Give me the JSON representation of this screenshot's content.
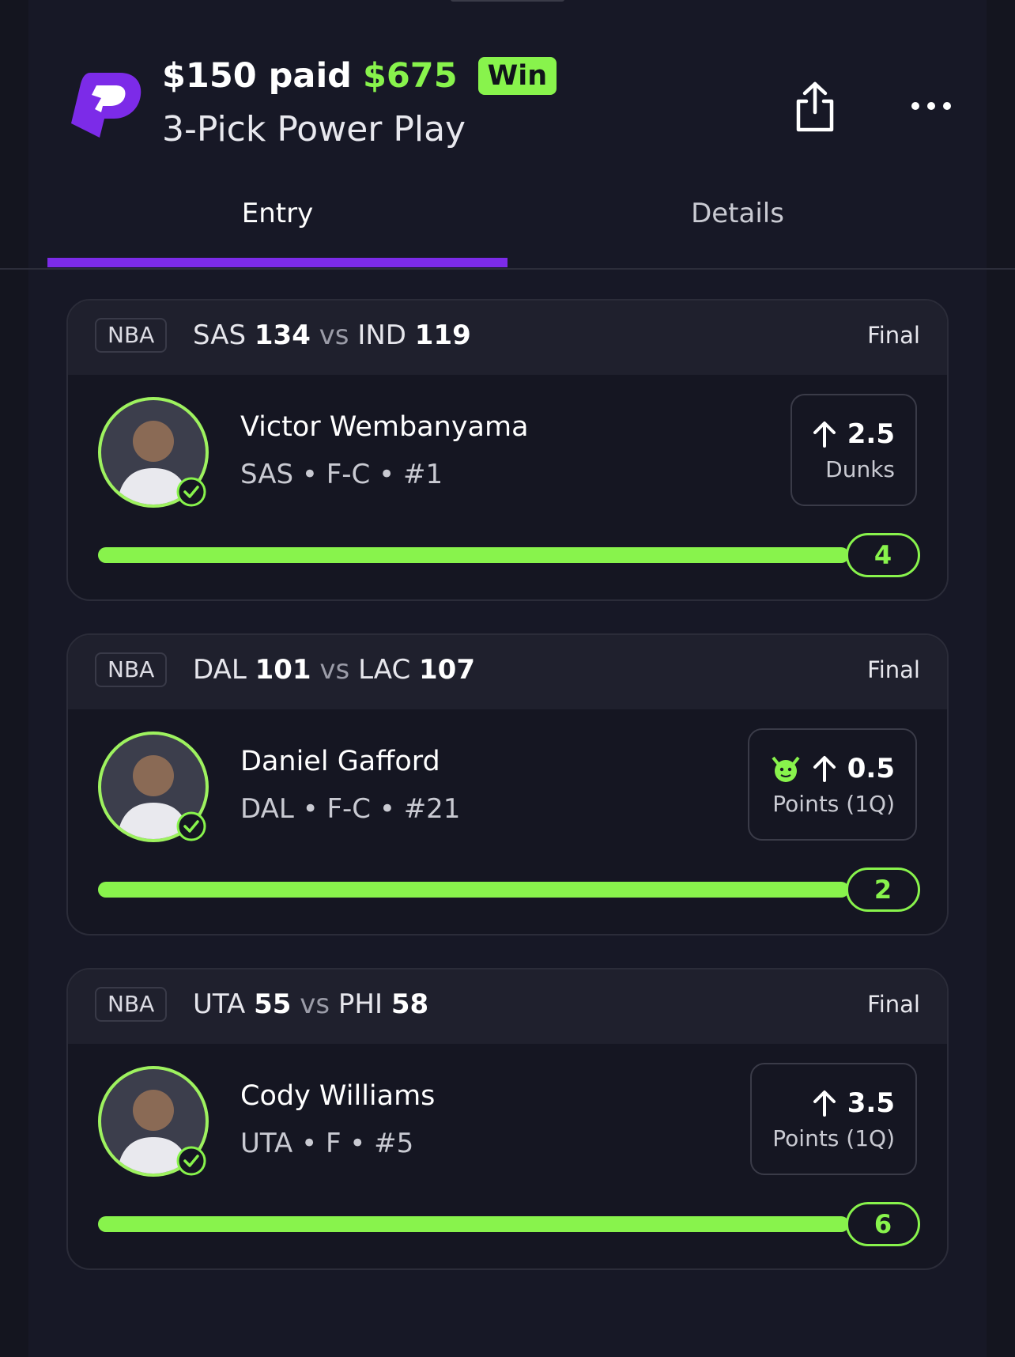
{
  "colors": {
    "accent_green": "#88f34c",
    "accent_purple": "#7c2be8",
    "background": "#171826"
  },
  "header": {
    "paid": "$150 paid",
    "payout": "$675",
    "result_badge": "Win",
    "entry_type": "3-Pick Power Play",
    "icons": [
      "prizepicks-logo",
      "share-icon",
      "more-icon"
    ]
  },
  "tabs": [
    {
      "label": "Entry",
      "active": true
    },
    {
      "label": "Details",
      "active": false
    }
  ],
  "picks": [
    {
      "league": "NBA",
      "team1": "SAS",
      "score1": "134",
      "vs": "vs",
      "team2": "IND",
      "score2": "119",
      "status": "Final",
      "player": "Victor Wembanyama",
      "meta": "SAS • F-C • #1",
      "line": "2.5",
      "direction": "up",
      "stat": "Dunks",
      "result": "4",
      "progress": 1.0
    },
    {
      "league": "NBA",
      "team1": "DAL",
      "score1": "101",
      "vs": "vs",
      "team2": "LAC",
      "score2": "107",
      "status": "Final",
      "player": "Daniel Gafford",
      "meta": "DAL • F-C • #21",
      "line": "0.5",
      "direction": "up",
      "stat": "Points (1Q)",
      "result": "2",
      "progress": 1.0,
      "demon": true
    },
    {
      "league": "NBA",
      "team1": "UTA",
      "score1": "55",
      "vs": "vs",
      "team2": "PHI",
      "score2": "58",
      "status": "Final",
      "player": "Cody Williams",
      "meta": "UTA • F • #5",
      "line": "3.5",
      "direction": "up",
      "stat": "Points (1Q)",
      "result": "6",
      "progress": 1.0
    }
  ]
}
